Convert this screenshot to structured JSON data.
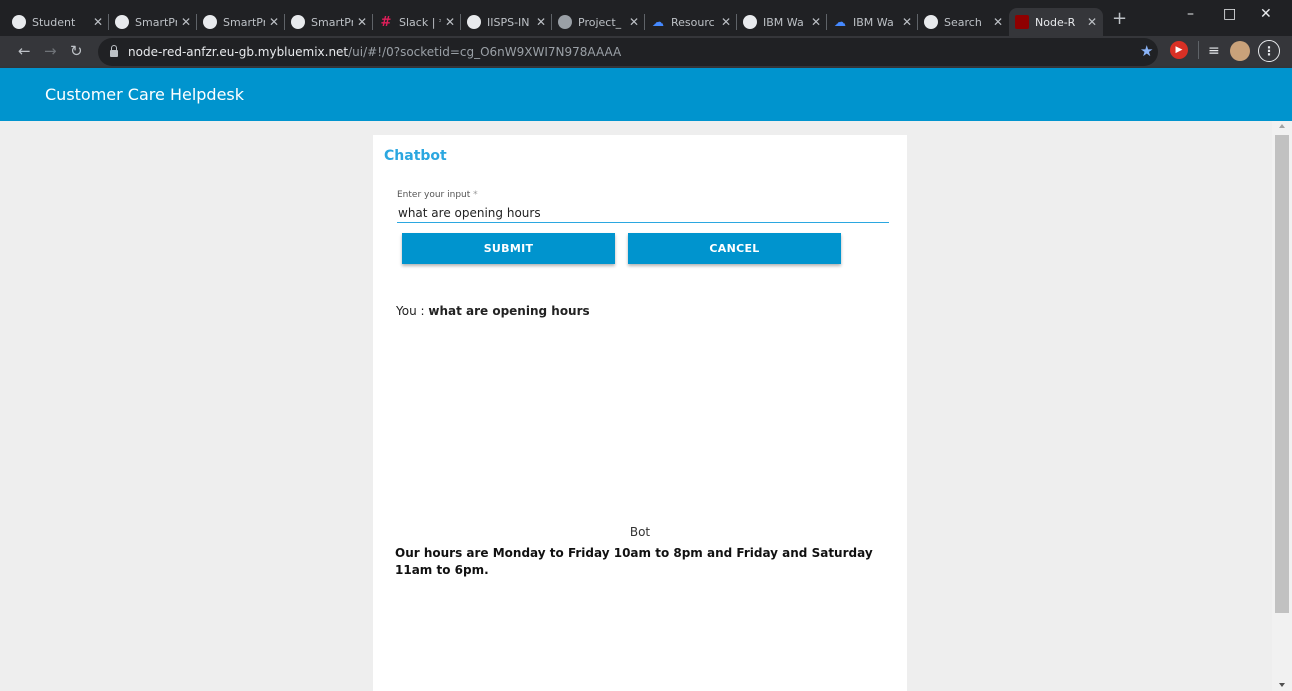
{
  "browser": {
    "tabs": [
      {
        "title": "Student",
        "icon": "globe-icon",
        "color": "#e8eaed"
      },
      {
        "title": "SmartPr",
        "icon": "github-icon",
        "color": "#e8eaed"
      },
      {
        "title": "SmartPr",
        "icon": "github-icon",
        "color": "#e8eaed"
      },
      {
        "title": "SmartPr",
        "icon": "github-icon",
        "color": "#e8eaed"
      },
      {
        "title": "Slack | *",
        "icon": "slack-icon",
        "color": "#e01e5a"
      },
      {
        "title": "IISPS-IN",
        "icon": "github-icon",
        "color": "#e8eaed"
      },
      {
        "title": "Project_",
        "icon": "globe-icon",
        "color": "#9aa0a6"
      },
      {
        "title": "Resourc",
        "icon": "ibm-cloud-icon",
        "color": "#4589ff"
      },
      {
        "title": "IBM Wa",
        "icon": "watson-icon",
        "color": "#e8eaed"
      },
      {
        "title": "IBM Wa",
        "icon": "ibm-cloud-icon",
        "color": "#4589ff"
      },
      {
        "title": "Search",
        "icon": "github-icon",
        "color": "#e8eaed"
      },
      {
        "title": "Node-R",
        "icon": "node-red-icon",
        "color": "#8f0000",
        "active": true
      }
    ],
    "url_host": "node-red-anfzr.eu-gb.mybluemix.net",
    "url_path": "/ui/#!/0?socketid=cg_O6nW9XWI7N978AAAA"
  },
  "app": {
    "title": "Customer Care Helpdesk",
    "accent_color": "#0094ce"
  },
  "chatbot": {
    "title": "Chatbot",
    "input_label": "Enter your input",
    "required_mark": "*",
    "input_value": "what are opening hours",
    "submit_label": "SUBMIT",
    "cancel_label": "CANCEL",
    "you_prefix": "You : ",
    "you_message": "what are opening hours",
    "bot_label": "Bot",
    "bot_reply": "Our hours are Monday to Friday 10am to 8pm and Friday and Saturday 11am to 6pm."
  }
}
